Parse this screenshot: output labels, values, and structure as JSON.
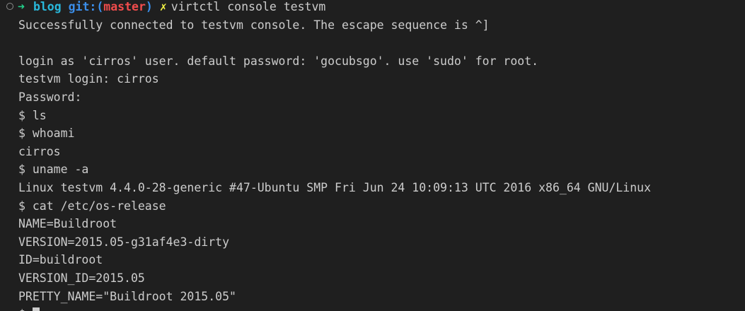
{
  "prompt": {
    "arrow": "➜",
    "directory": "blog",
    "git_label": "git:(",
    "branch": "master",
    "git_close": ")",
    "dirty_marker": "✗",
    "command": "virtctl console testvm"
  },
  "output_lines": [
    "Successfully connected to testvm console. The escape sequence is ^]",
    "",
    "login as 'cirros' user. default password: 'gocubsgo'. use 'sudo' for root.",
    "testvm login: cirros",
    "Password:",
    "$ ls",
    "$ whoami",
    "cirros",
    "$ uname -a",
    "Linux testvm 4.4.0-28-generic #47-Ubuntu SMP Fri Jun 24 10:09:13 UTC 2016 x86_64 GNU/Linux",
    "$ cat /etc/os-release",
    "NAME=Buildroot",
    "VERSION=2015.05-g31af4e3-dirty",
    "ID=buildroot",
    "VERSION_ID=2015.05",
    "PRETTY_NAME=\"Buildroot 2015.05\""
  ],
  "current_prompt": "$ ",
  "colors": {
    "background": "#1f1f1f",
    "foreground": "#cccccc",
    "arrow": "#23d18b",
    "directory": "#29b8db",
    "git": "#3b8eea",
    "branch": "#f14c4c",
    "dirty": "#f5f543"
  }
}
